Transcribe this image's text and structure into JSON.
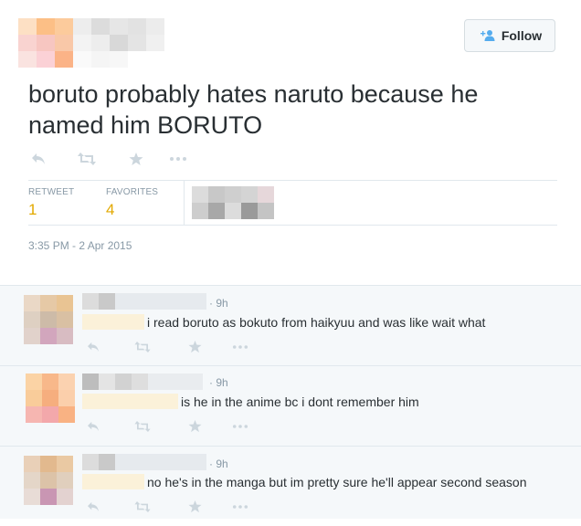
{
  "header": {
    "follow_label": "Follow",
    "follow_icon": "add-user-icon"
  },
  "tweet": {
    "text": "boruto probably hates naruto because he named him BORUTO",
    "stats": {
      "retweets_label": "RETWEET",
      "retweets": "1",
      "favorites_label": "FAVORITES",
      "favorites": "4"
    },
    "timestamp": "3:35 PM - 2 Apr 2015"
  },
  "replies": [
    {
      "time": "· 9h",
      "text": "i read boruto as bokuto from haikyuu and was like wait what"
    },
    {
      "time": "· 9h",
      "text": "is he in the anime bc i dont remember him"
    },
    {
      "time": "· 9h",
      "text": "no he's in the manga but im pretty sure he'll appear second season"
    }
  ],
  "colors": {
    "accent": "#55acee",
    "stat_value": "#e2a900",
    "muted": "#8899a6",
    "reply_bg": "#f5f8fa"
  }
}
